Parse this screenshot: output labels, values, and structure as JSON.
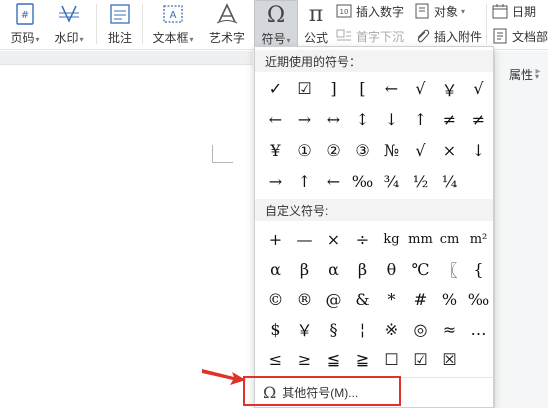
{
  "ribbon": {
    "page_number": "页码",
    "watermark": "水印",
    "comment": "批注",
    "textbox": "文本框",
    "wordart": "艺术字",
    "symbol": "符号",
    "formula": "公式",
    "insert_number": "插入数字",
    "object": "对象",
    "drop_cap": "首字下沉",
    "insert_attachment": "插入附件",
    "date": "日期",
    "doc_part": "文档部"
  },
  "side_panel": {
    "properties": "属性"
  },
  "symbol_menu": {
    "recent_header": "近期使用的符号：",
    "recent_symbols": [
      "✓",
      "☑",
      "]",
      "[",
      "←",
      "√",
      "￥",
      "√",
      "←",
      "→",
      "↔",
      "↕",
      "↓",
      "↑",
      "≠",
      "≠",
      "¥",
      "①",
      "②",
      "③",
      "№",
      "√",
      "×",
      "↓",
      "→",
      "↑",
      "←",
      "‰",
      "¾",
      "½",
      "¼"
    ],
    "custom_header": "自定义符号:",
    "custom_symbols": [
      "+",
      "—",
      "×",
      "÷",
      "kg",
      "mm",
      "cm",
      "m²",
      "α",
      "β",
      "α",
      "β",
      "θ",
      "℃",
      "〖",
      "{",
      "©",
      "®",
      "@",
      "&",
      "*",
      "#",
      "%",
      "‰",
      "$",
      "￥",
      "§",
      "¦",
      "※",
      "◎",
      "≈",
      "…",
      "≤",
      "≥",
      "≦",
      "≧",
      "☐",
      "☑",
      "☒"
    ],
    "more_symbols": "其他符号(M)..."
  },
  "colors": {
    "highlight": "#e0312a",
    "active_button": "#d4d8dd"
  }
}
